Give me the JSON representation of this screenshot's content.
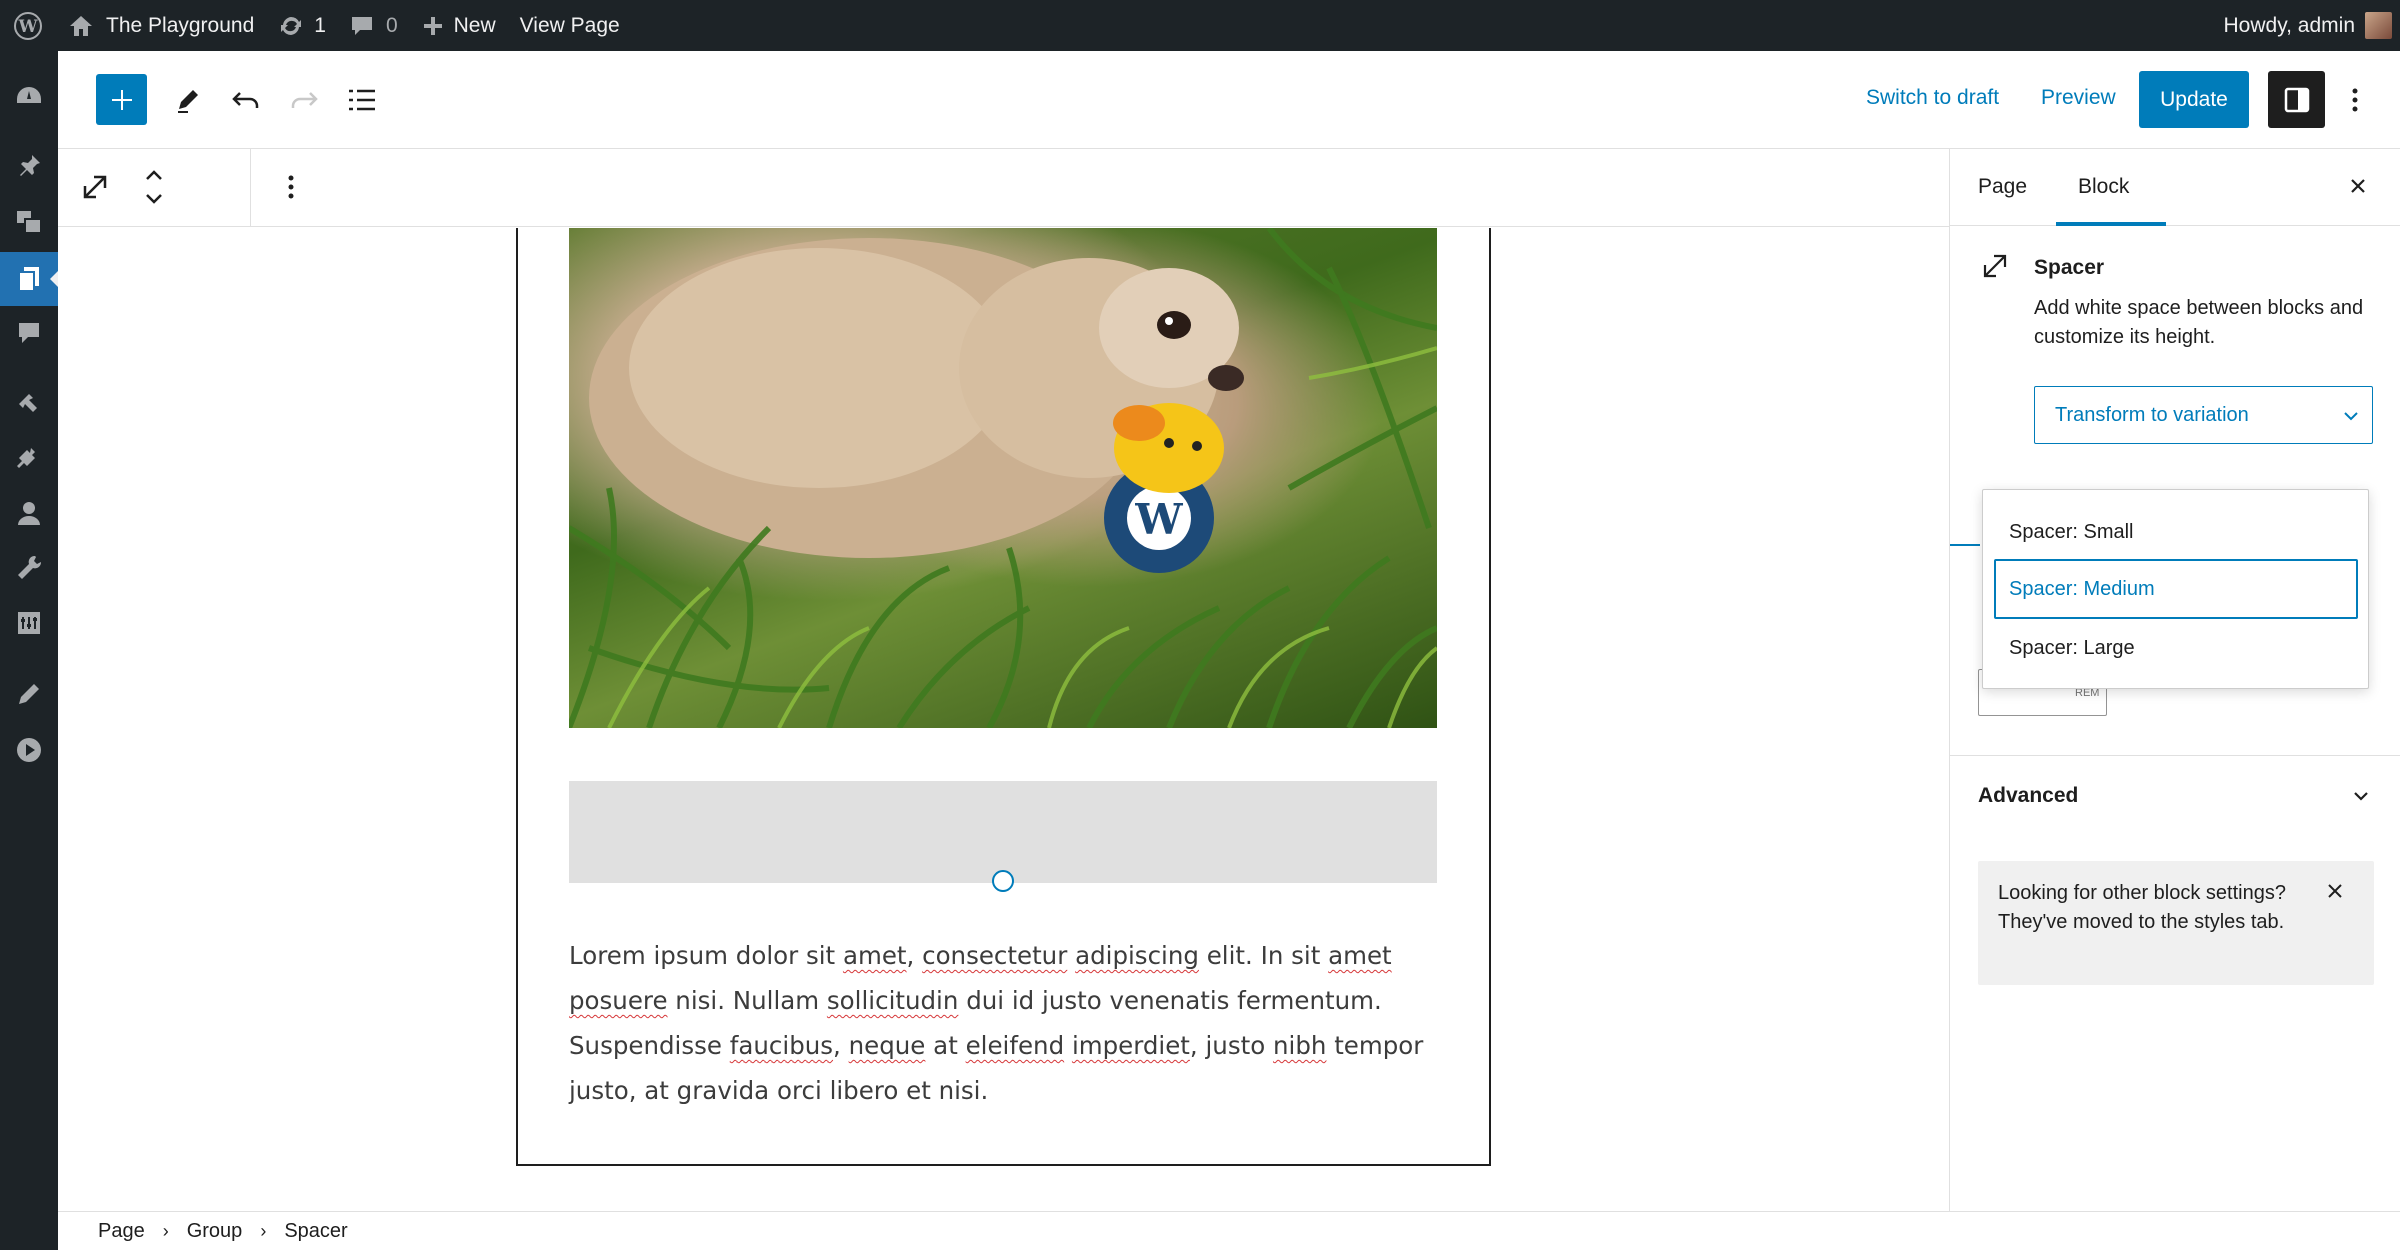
{
  "admin_bar": {
    "site_name": "The Playground",
    "updates_count": "1",
    "comments_count": "0",
    "new_label": "New",
    "view_page_label": "View Page",
    "howdy": "Howdy, admin"
  },
  "header": {
    "switch_to_draft": "Switch to draft",
    "preview": "Preview",
    "update": "Update"
  },
  "canvas": {
    "paragraph": {
      "parts": [
        {
          "t": "Lorem ipsum dolor sit ",
          "s": false
        },
        {
          "t": "amet",
          "s": true
        },
        {
          "t": ", ",
          "s": false
        },
        {
          "t": "consectetur",
          "s": true
        },
        {
          "t": " ",
          "s": false
        },
        {
          "t": "adipiscing",
          "s": true
        },
        {
          "t": " elit. In sit ",
          "s": false
        },
        {
          "t": "amet",
          "s": true
        },
        {
          "t": " ",
          "s": false
        },
        {
          "t": "posuere",
          "s": true
        },
        {
          "t": " nisi. Nullam ",
          "s": false
        },
        {
          "t": "sollicitudin",
          "s": true
        },
        {
          "t": " dui id justo venenatis fermentum. Suspendisse ",
          "s": false
        },
        {
          "t": "faucibus",
          "s": true
        },
        {
          "t": ", ",
          "s": false
        },
        {
          "t": "neque",
          "s": true
        },
        {
          "t": " at ",
          "s": false
        },
        {
          "t": "eleifend",
          "s": true
        },
        {
          "t": " ",
          "s": false
        },
        {
          "t": "imperdiet",
          "s": true
        },
        {
          "t": ", justo ",
          "s": false
        },
        {
          "t": "nibh",
          "s": true
        },
        {
          "t": " tempor justo, at gravida orci libero et nisi.",
          "s": false
        }
      ]
    }
  },
  "breadcrumb": [
    "Page",
    "Group",
    "Spacer"
  ],
  "inspector": {
    "tabs": [
      "Page",
      "Block"
    ],
    "active_tab": "Block",
    "block_title": "Spacer",
    "block_description": "Add white space between blocks and customize its height.",
    "variation_select": "Transform to variation",
    "variation_options": [
      "Spacer: Small",
      "Spacer: Medium",
      "Spacer: Large"
    ],
    "focused_option": "Spacer: Medium",
    "height_unit": "REM",
    "advanced_label": "Advanced",
    "notice_text": "Looking for other block settings? They've moved to the styles tab."
  },
  "colors": {
    "accent": "#007cba",
    "admin_bar_bg": "#1d2327",
    "spacer_bg": "#e0e0e0"
  },
  "icons": [
    "wordpress-logo-icon",
    "home-icon",
    "updates-icon",
    "comment-icon",
    "plus-icon",
    "pencil-icon",
    "undo-icon",
    "redo-icon",
    "list-view-icon",
    "sidebar-toggle-icon",
    "more-vertical-icon",
    "resize-icon",
    "move-up-down-icon",
    "close-icon",
    "chevron-down-icon"
  ]
}
